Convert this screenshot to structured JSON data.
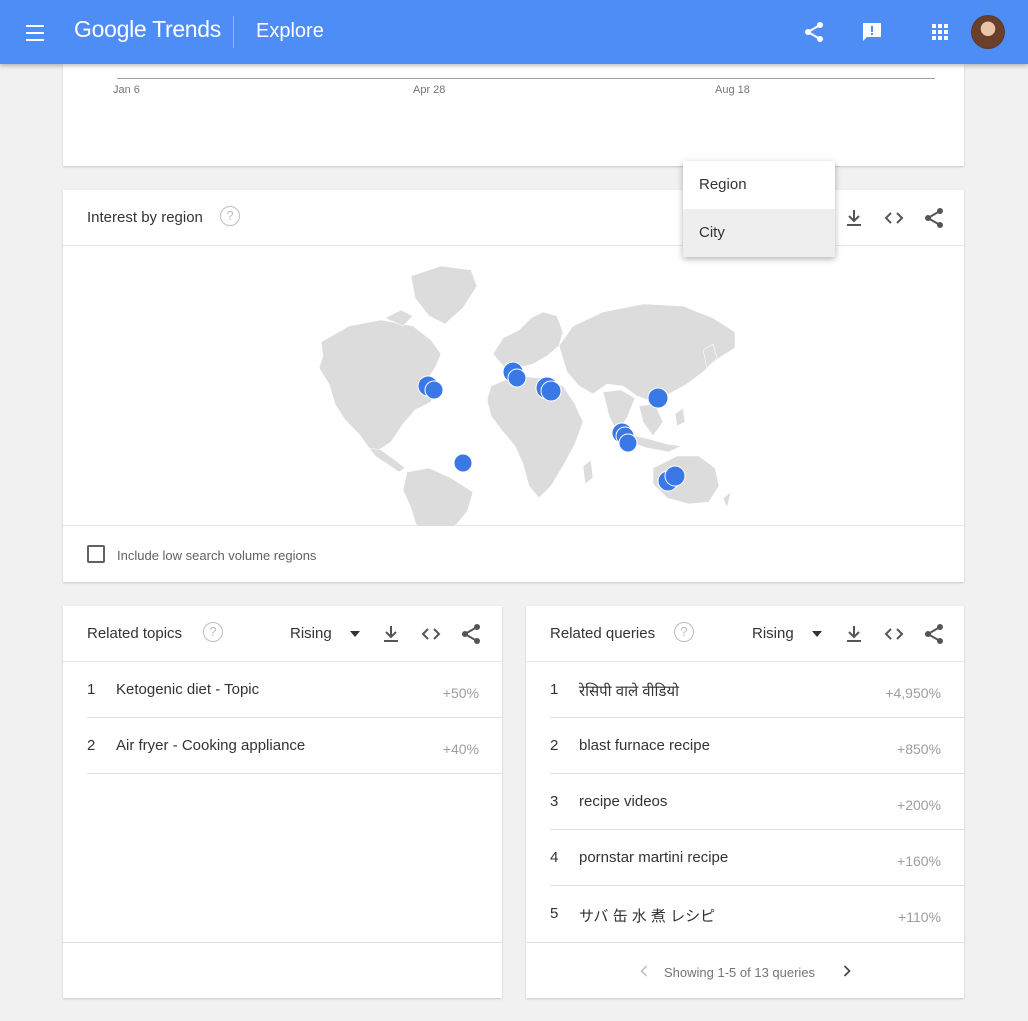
{
  "header": {
    "logo_google": "Google",
    "logo_trends": "Trends",
    "page_title": "Explore",
    "icons": [
      "menu-icon",
      "share-icon",
      "feedback-icon",
      "apps-icon",
      "avatar"
    ],
    "bar_color": "#4e8df5"
  },
  "timeline": {
    "ticks": [
      "Jan 6",
      "Apr 28",
      "Aug 18"
    ]
  },
  "region": {
    "title": "Interest by region",
    "help": "?",
    "menu_options": [
      "Region",
      "City"
    ],
    "selected_option": "City",
    "low_volume_label": "Include low search volume regions",
    "low_volume_checked": false,
    "marker_color": "#3a78e6"
  },
  "topics": {
    "title": "Related topics",
    "help": "?",
    "filter": "Rising",
    "rows": [
      {
        "rank": "1",
        "label": "Ketogenic diet - Topic",
        "value": "+50%"
      },
      {
        "rank": "2",
        "label": "Air fryer - Cooking appliance",
        "value": "+40%"
      }
    ]
  },
  "queries": {
    "title": "Related queries",
    "help": "?",
    "filter": "Rising",
    "rows": [
      {
        "rank": "1",
        "label": "रेसिपी वाले वीडियो",
        "value": "+4,950%"
      },
      {
        "rank": "2",
        "label": "blast furnace recipe",
        "value": "+850%"
      },
      {
        "rank": "3",
        "label": "recipe videos",
        "value": "+200%"
      },
      {
        "rank": "4",
        "label": "pornstar martini recipe",
        "value": "+160%"
      },
      {
        "rank": "5",
        "label": "サバ 缶 水 煮 レシピ",
        "value": "+110%"
      }
    ],
    "pager": "Showing 1-5 of 13 queries"
  }
}
